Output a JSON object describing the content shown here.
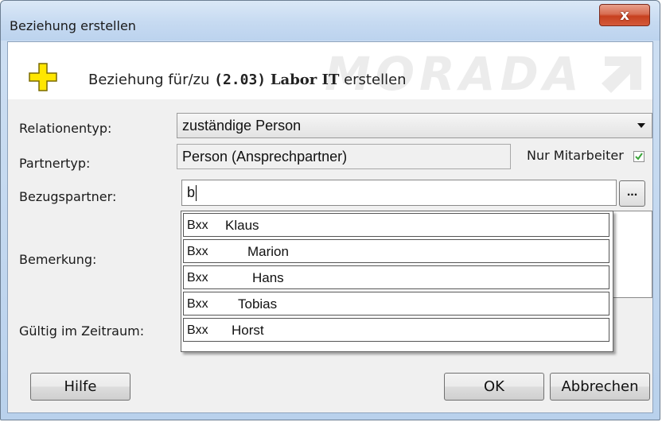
{
  "window": {
    "title": "Beziehung erstellen",
    "close_glyph": "x"
  },
  "header": {
    "prefix": "Beziehung für/zu ",
    "code": "(2.03)",
    "name": "Labor IT",
    "suffix": " erstellen",
    "watermark": "MORADA",
    "icon": "plus-icon",
    "icon_color": "#ffe600"
  },
  "form": {
    "relationentyp_label": "Relationentyp:",
    "relationentyp_value": "zuständige Person",
    "partnertyp_label": "Partnertyp:",
    "partnertyp_value": "Person (Ansprechpartner)",
    "nur_mitarbeiter_label": "Nur Mitarbeiter",
    "nur_mitarbeiter_checked": true,
    "bezugspartner_label": "Bezugspartner:",
    "bezugspartner_value": "b",
    "browse_label": "...",
    "bemerkung_label": "Bemerkung:",
    "gueltig_label": "Gültig im Zeitraum:"
  },
  "suggestions": [
    {
      "prefix": "Bxx",
      "name": "Klaus"
    },
    {
      "prefix": "Bxx",
      "name": "Marion"
    },
    {
      "prefix": "Bxx",
      "name": "Hans"
    },
    {
      "prefix": "Bxx",
      "name": "Tobias"
    },
    {
      "prefix": "Bxx",
      "name": "Horst"
    }
  ],
  "buttons": {
    "help": "Hilfe",
    "ok": "OK",
    "cancel": "Abbrechen"
  },
  "colors": {
    "checkmark": "#3aa53a",
    "plus_fill": "#ffe600",
    "plus_stroke": "#7a6a00"
  }
}
